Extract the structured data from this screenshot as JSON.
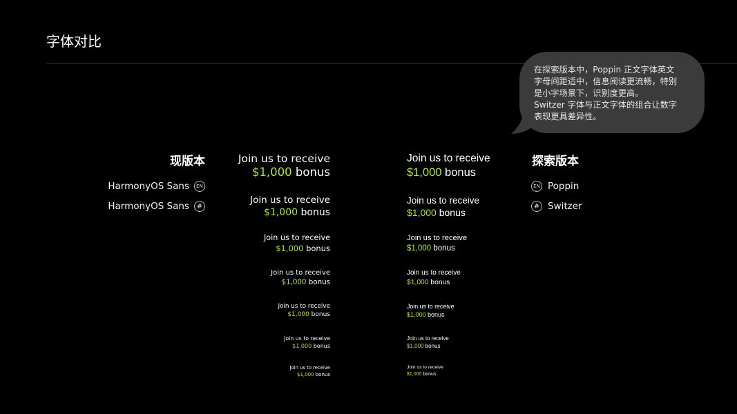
{
  "title": "字体对比",
  "bubble": "在探索版本中，Poppin 正文字体英文\n字母间距适中，信息阅读更流畅，特别\n是小字场景下，识别度更高。\nSwitzer 字体与正文字体的组合让数字\n表现更具差异性。",
  "colors": {
    "accent": "#b0e830",
    "background": "#000000",
    "bubble": "#3b3b3b"
  },
  "left": {
    "title": "现版本",
    "fonts": [
      {
        "name": "HarmonyOS Sans",
        "badge": "EN",
        "icon": "en-circle-icon"
      },
      {
        "name": "HarmonyOS Sans",
        "badge": "#",
        "icon": "hash-circle-icon"
      }
    ]
  },
  "right": {
    "title": "探索版本",
    "fonts": [
      {
        "name": "Poppin",
        "badge": "EN",
        "icon": "en-circle-icon"
      },
      {
        "name": "Switzer",
        "badge": "#",
        "icon": "hash-circle-icon"
      }
    ]
  },
  "samples": [
    {
      "line1": "Join us to receive",
      "amount": "$1,000",
      "suffix": " bonus"
    },
    {
      "line1": "Join us to receive",
      "amount": "$1,000",
      "suffix": " bonus"
    },
    {
      "line1": "Join us to receive",
      "amount": "$1,000",
      "suffix": " bonus"
    },
    {
      "line1": "Join us to receive",
      "amount": "$1,000",
      "suffix": " bonus"
    },
    {
      "line1": "Join us to receive",
      "amount": "$1,000",
      "suffix": " bonus"
    },
    {
      "line1": "Join us to receive",
      "amount": "$1,000",
      "suffix": " bonus"
    },
    {
      "line1": "Join us to receive",
      "amount": "$1,000",
      "suffix": " bonus"
    }
  ]
}
